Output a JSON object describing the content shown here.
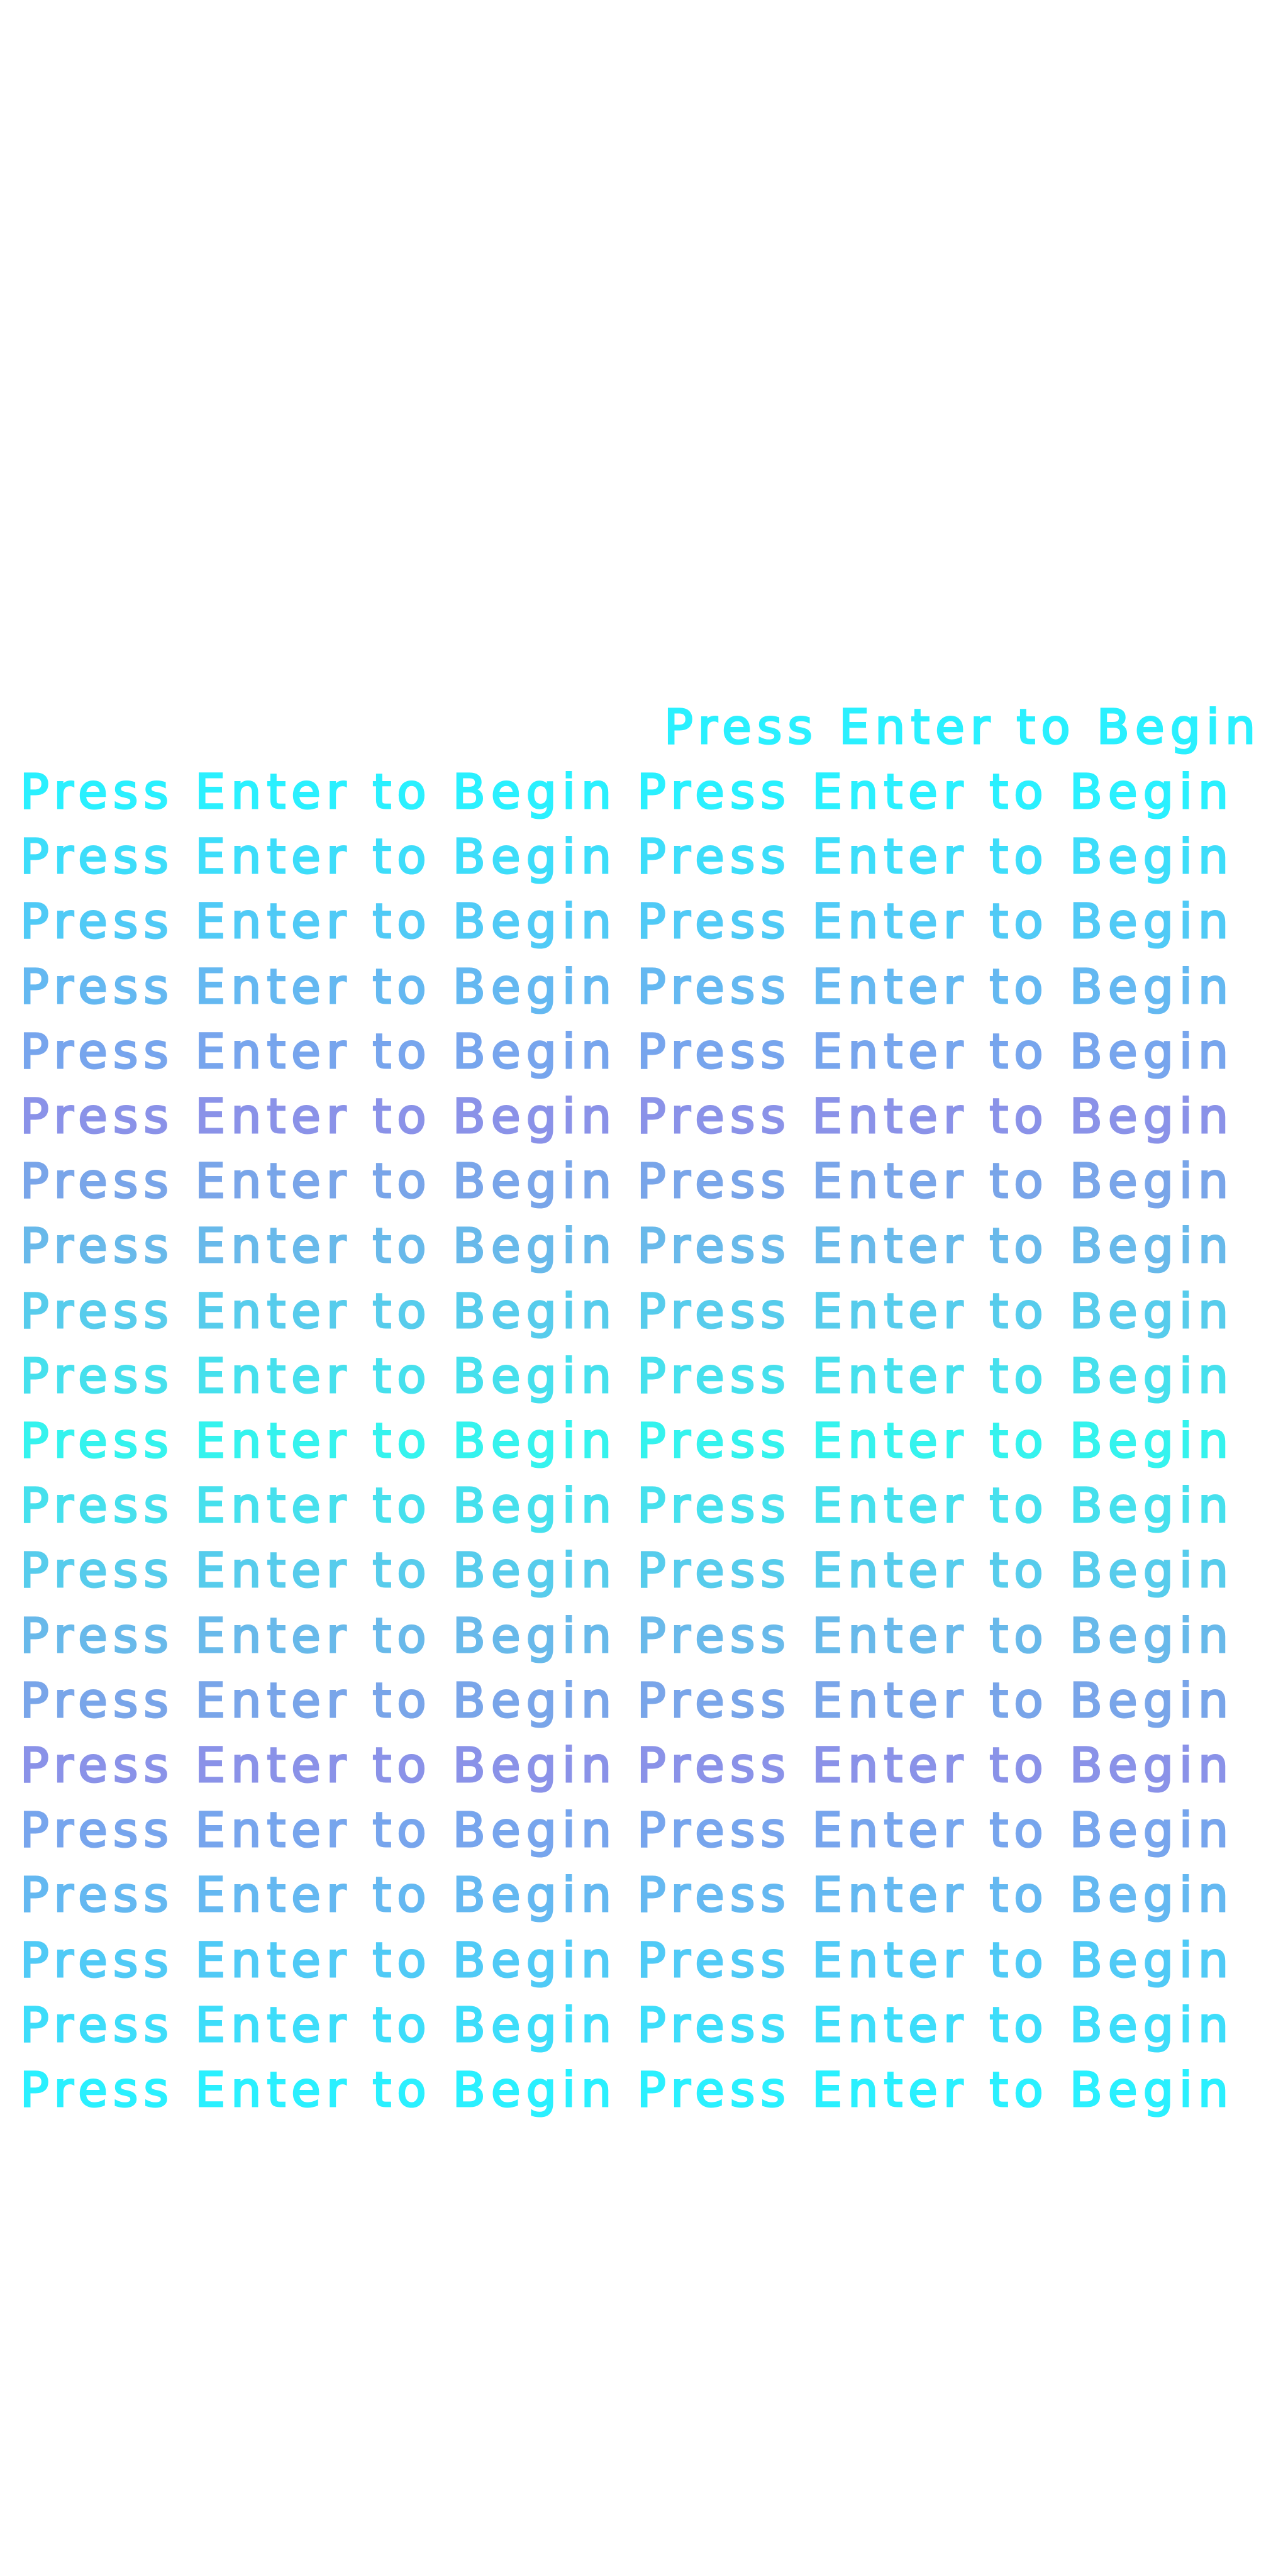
{
  "screen": {
    "prompt_text": "Press Enter to Begin",
    "colors": {
      "background": "#ffffff",
      "gradient_start": "#2af0ff",
      "gradient_mid": "#8a92e8",
      "gradient_end": "#35f3ee"
    }
  }
}
